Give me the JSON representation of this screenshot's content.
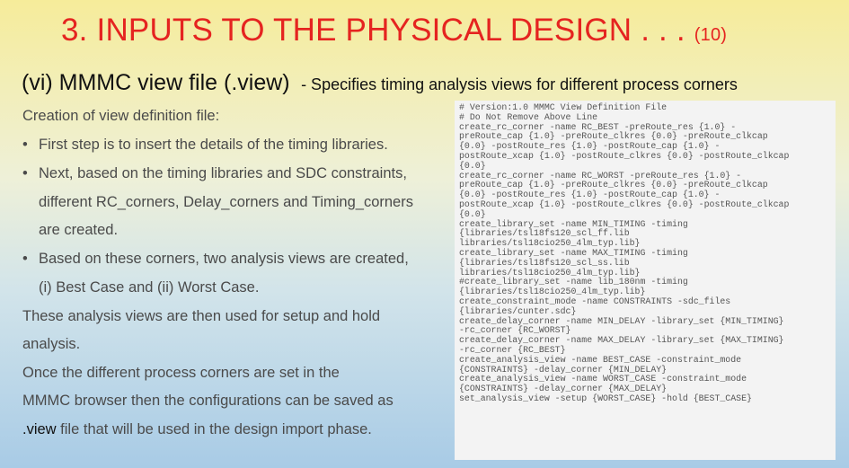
{
  "title": {
    "main": "3. INPUTS TO THE PHYSICAL DESIGN . . .",
    "number": "(10)"
  },
  "subtitle": {
    "main": "(vi) MMMC view file (.view)",
    "desc": "- Specifies timing analysis views for different process corners"
  },
  "body": {
    "intro": "Creation of view definition file:",
    "bullets": [
      {
        "lines": [
          "First step is to insert the details of the timing libraries."
        ]
      },
      {
        "lines": [
          "Next, based on the timing libraries and SDC constraints,",
          "different RC_corners, Delay_corners and Timing_corners",
          "are created."
        ]
      },
      {
        "lines": [
          "Based on these corners, two analysis  views are created,",
          "(i) Best Case and (ii) Worst Case."
        ]
      }
    ],
    "para1": [
      "These analysis views are then used for setup and hold",
      "analysis."
    ],
    "para2_lines": [
      "Once the different process corners are set in the",
      "MMMC browser then the configurations can be saved as"
    ],
    "para2_last_highlight": ".view",
    "para2_last_rest": " file that will be used in the design import phase."
  },
  "code": [
    "# Version:1.0 MMMC View Definition File",
    "# Do Not Remove Above Line",
    "create_rc_corner -name RC_BEST -preRoute_res {1.0} -",
    "preRoute_cap {1.0} -preRoute_clkres {0.0} -preRoute_clkcap",
    "{0.0} -postRoute_res {1.0} -postRoute_cap {1.0} -",
    "postRoute_xcap {1.0} -postRoute_clkres {0.0} -postRoute_clkcap",
    "{0.0}",
    "create_rc_corner -name RC_WORST -preRoute_res {1.0} -",
    "preRoute_cap {1.0} -preRoute_clkres {0.0} -preRoute_clkcap",
    "{0.0} -postRoute_res {1.0} -postRoute_cap {1.0} -",
    "postRoute_xcap {1.0} -postRoute_clkres {0.0} -postRoute_clkcap",
    "{0.0}",
    "create_library_set -name MIN_TIMING -timing",
    "{libraries/tsl18fs120_scl_ff.lib",
    "libraries/tsl18cio250_4lm_typ.lib}",
    "create_library_set -name MAX_TIMING -timing",
    "{libraries/tsl18fs120_scl_ss.lib",
    "libraries/tsl18cio250_4lm_typ.lib}",
    "#create_library_set -name lib_180nm -timing",
    "{libraries/tsl18cio250_4lm_typ.lib}",
    "create_constraint_mode -name CONSTRAINTS -sdc_files",
    "{libraries/cunter.sdc}",
    "create_delay_corner -name MIN_DELAY -library_set {MIN_TIMING}",
    "-rc_corner {RC_WORST}",
    "create_delay_corner -name MAX_DELAY -library_set {MAX_TIMING}",
    "-rc_corner {RC_BEST}",
    "create_analysis_view -name BEST_CASE -constraint_mode",
    "{CONSTRAINTS} -delay_corner {MIN_DELAY}",
    "create_analysis_view -name WORST_CASE -constraint_mode",
    "{CONSTRAINTS} -delay_corner {MAX_DELAY}",
    "set_analysis_view -setup {WORST_CASE} -hold {BEST_CASE}"
  ]
}
